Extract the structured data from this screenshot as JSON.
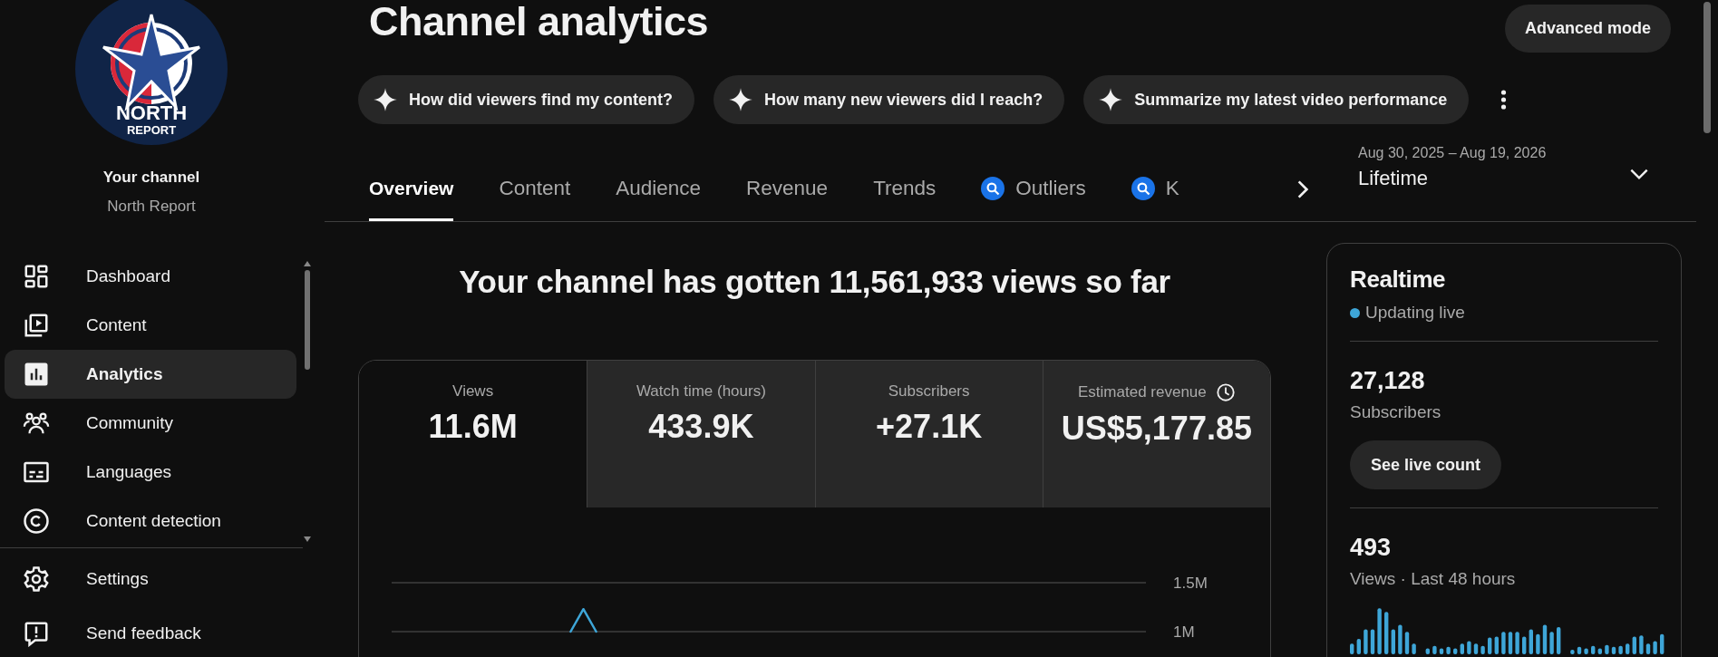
{
  "channel": {
    "logo_text": [
      "NORTH",
      "REPORT"
    ],
    "label": "Your channel",
    "name": "North Report"
  },
  "sidebar": {
    "items": [
      {
        "label": "Dashboard",
        "selected": false
      },
      {
        "label": "Content",
        "selected": false
      },
      {
        "label": "Analytics",
        "selected": true
      },
      {
        "label": "Community",
        "selected": false
      },
      {
        "label": "Languages",
        "selected": false
      },
      {
        "label": "Content detection",
        "selected": false
      }
    ],
    "footer_items": [
      {
        "label": "Settings"
      },
      {
        "label": "Send feedback"
      }
    ]
  },
  "header": {
    "title": "Channel analytics",
    "advanced_button": "Advanced mode",
    "suggestions": [
      "How did viewers find my content?",
      "How many new viewers did I reach?",
      "Summarize my latest video performance"
    ]
  },
  "tabs": [
    {
      "label": "Overview",
      "kind": "plain",
      "selected": true
    },
    {
      "label": "Content",
      "kind": "plain",
      "selected": false
    },
    {
      "label": "Audience",
      "kind": "plain",
      "selected": false
    },
    {
      "label": "Revenue",
      "kind": "plain",
      "selected": false
    },
    {
      "label": "Trends",
      "kind": "plain",
      "selected": false
    },
    {
      "label": "Outliers",
      "kind": "extension",
      "selected": false
    },
    {
      "label": "K",
      "kind": "extension",
      "selected": false
    }
  ],
  "date_range": {
    "range": "Aug 30, 2025 – Aug 19, 2026",
    "period": "Lifetime"
  },
  "overview": {
    "headline": "Your channel has gotten 11,561,933 views so far",
    "metrics": [
      {
        "label": "Views",
        "value": "11.6M",
        "kind": "plain",
        "selected": true
      },
      {
        "label": "Watch time (hours)",
        "value": "433.9K",
        "kind": "plain",
        "selected": false
      },
      {
        "label": "Subscribers",
        "value": "+27.1K",
        "kind": "plain",
        "selected": false
      },
      {
        "label": "Estimated revenue",
        "value": "US$5,177.85",
        "kind": "timed",
        "selected": false
      }
    ],
    "chart_data": {
      "type": "line",
      "ylim": [
        1000000,
        1500000
      ],
      "yticks": [
        {
          "value": 1000000,
          "label": "1M"
        },
        {
          "value": 1500000,
          "label": "1.5M"
        }
      ],
      "series": [
        {
          "color": "#3ea6d8",
          "values": [
            null,
            null,
            null,
            null,
            null,
            null,
            null,
            null,
            null,
            null,
            null,
            null,
            null,
            null,
            1000000,
            1230000,
            1000000,
            null,
            null,
            null,
            null,
            null,
            null,
            null,
            null,
            null,
            null,
            null,
            null,
            null,
            null,
            null,
            null,
            null,
            null,
            null,
            null,
            null,
            null,
            null,
            null,
            null,
            null,
            null,
            null,
            null,
            null,
            null,
            null,
            null,
            null,
            null,
            null,
            null,
            null,
            null,
            null,
            null,
            null,
            null
          ]
        }
      ]
    }
  },
  "realtime": {
    "title": "Realtime",
    "status": "Updating live",
    "subscribers": {
      "value": "27,128",
      "label": "Subscribers"
    },
    "live_count_button": "See live count",
    "views": {
      "value": "493",
      "label": "Views · Last 48 hours"
    }
  }
}
